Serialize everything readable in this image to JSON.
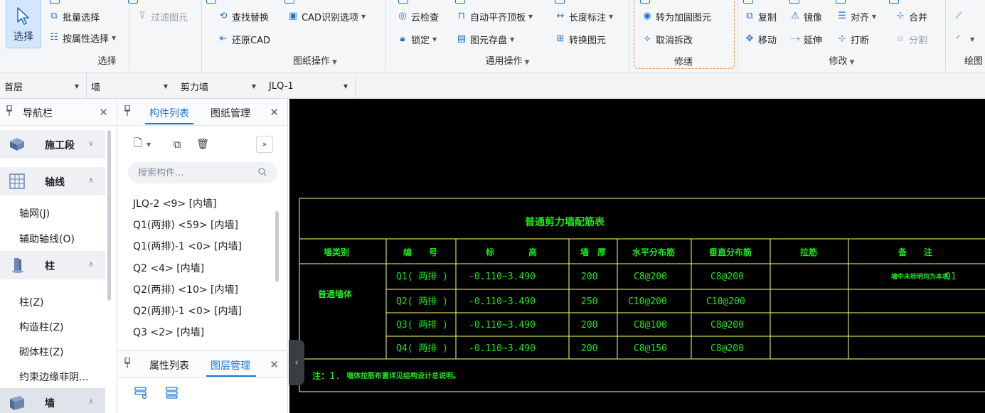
{
  "ribbon": {
    "select_group": {
      "big_button": "选择",
      "batch_select": "批量选择",
      "filter_elements": "过滤图元",
      "select_by_property": "按属性选择",
      "caption": "选择"
    },
    "drawing_ops": {
      "find_replace": "查找替换",
      "cad_options": "CAD识别选项",
      "restore_cad": "还原CAD",
      "caption": "图纸操作"
    },
    "general_ops": {
      "cloud_check": "云检查",
      "auto_level_slab": "自动平齐顶板",
      "length_dim": "长度标注",
      "lock": "锁定",
      "element_store": "图元存盘",
      "convert_element": "转换图元",
      "caption": "通用操作"
    },
    "repair": {
      "to_reinforce": "转为加固图元",
      "cancel_dismantle": "取消拆改",
      "caption": "修缮"
    },
    "modify": {
      "copy": "复制",
      "mirror": "镜像",
      "align": "对齐",
      "merge": "合并",
      "move": "移动",
      "extend": "延伸",
      "break": "打断",
      "split": "分割",
      "caption": "修改"
    },
    "draw": {
      "caption": "绘图"
    }
  },
  "filters": {
    "floor": "首层",
    "type": "墙",
    "subtype": "剪力墙",
    "component": "JLQ-1"
  },
  "nav": {
    "title": "导航栏",
    "categories": [
      {
        "label": "施工段"
      },
      {
        "label": "轴线"
      },
      {
        "label": "柱"
      },
      {
        "label": "墙"
      }
    ],
    "axis_items": [
      "轴网(J)",
      "辅助轴线(O)"
    ],
    "column_items": [
      "柱(Z)",
      "构造柱(Z)",
      "砌体柱(Z)",
      "约束边缘非阴..."
    ]
  },
  "components": {
    "tabs": [
      "构件列表",
      "图纸管理"
    ],
    "search_placeholder": "搜索构件...",
    "items": [
      "JLQ-2 <9> [内墙]",
      "Q1(两排) <59> [内墙]",
      "Q1(两排)-1 <0> [内墙]",
      "Q2 <4> [内墙]",
      "Q2(两排) <10> [内墙]",
      "Q2(两排)-1 <0> [内墙]",
      "Q3 <2> [内墙]"
    ]
  },
  "properties": {
    "tabs": [
      "属性列表",
      "图层管理"
    ]
  },
  "cad_table": {
    "title": "普通剪力墙配筋表",
    "headers": [
      "墙类别",
      "编　　号",
      "标　　　　高",
      "墙　厚",
      "水平分布筋",
      "垂直分布筋",
      "拉筋",
      "备　　注"
    ],
    "category": "普通墙体",
    "rows": [
      {
        "id": "Q1(  两排 )",
        "elev": "-0.110~3.490",
        "thick": "200",
        "horiz": "C8@200",
        "vert": "C8@200",
        "tie": "",
        "note": "墙中未标明均为本表",
        "note2": "Q1"
      },
      {
        "id": "Q2(  两排 )",
        "elev": "-0.110~3.490",
        "thick": "250",
        "horiz": "C10@200",
        "vert": "C10@200",
        "tie": "",
        "note": "",
        "note2": ""
      },
      {
        "id": "Q3(  两排 )",
        "elev": "-0.110~3.490",
        "thick": "200",
        "horiz": "C8@100",
        "vert": "C8@200",
        "tie": "",
        "note": "",
        "note2": ""
      },
      {
        "id": "Q4(  两排 )",
        "elev": "-0.110~3.490",
        "thick": "200",
        "horiz": "C8@150",
        "vert": "C8@200",
        "tie": "",
        "note": "",
        "note2": ""
      }
    ],
    "note_prefix": "注：",
    "note_num": "1.",
    "note_text": "墙体拉筋布置详见结构设计总说明。"
  },
  "colors": {
    "accent": "#1a73d9",
    "repair_border": "#e98a3c",
    "cad_yellow": "#ffff66",
    "cad_green": "#19e619",
    "canvas_bg": "#000000"
  }
}
